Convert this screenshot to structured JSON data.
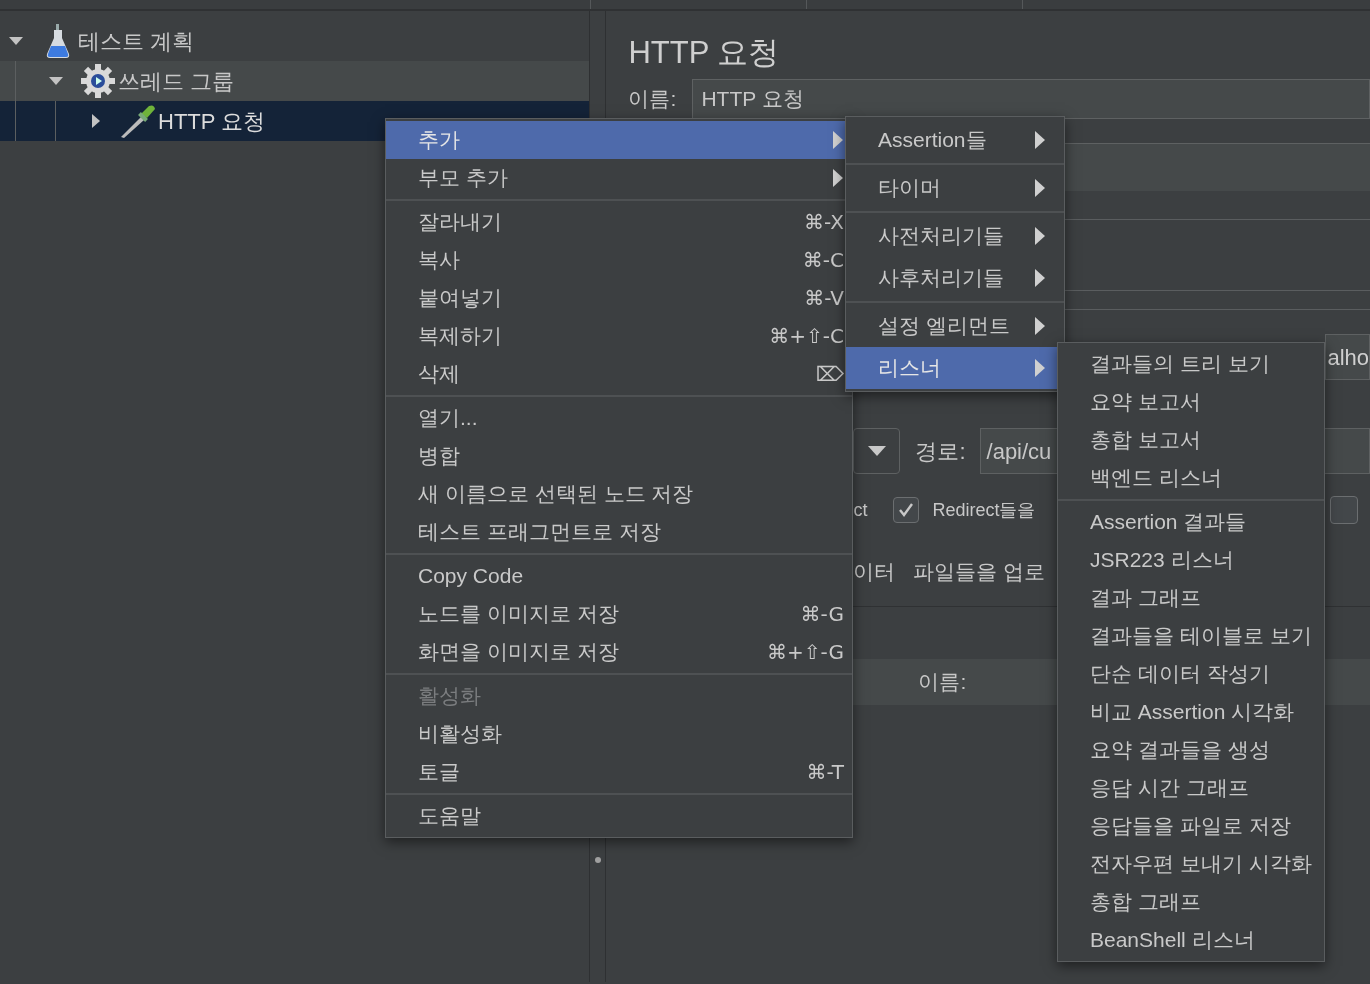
{
  "tree": [
    {
      "label": "테스트 계획",
      "kind": "test-plan",
      "expanded": true,
      "selected": false,
      "children": [
        {
          "label": "쓰레드 그룹",
          "kind": "thread-group",
          "expanded": true,
          "selected": false,
          "children": [
            {
              "label": "HTTP 요청",
              "kind": "sampler",
              "expanded": false,
              "selected": true
            }
          ]
        }
      ]
    }
  ],
  "editor": {
    "title": "HTTP 요청",
    "name_label": "이름:",
    "name_value": "HTTP 요청",
    "server_value": "alho",
    "path_label": "경로:",
    "path_value": "/api/cu",
    "text_1": "ct",
    "redirect": {
      "label": "Redirect들을",
      "checked": true
    },
    "checkbox_2": {
      "checked": false
    },
    "text_2": "이터",
    "text_3": "파일들을 업로",
    "name_label_2": "이름:"
  },
  "context_menu": [
    [
      {
        "label": "추가",
        "submenu": true,
        "selected": true,
        "disabled": false
      },
      {
        "label": "부모 추가",
        "submenu": true,
        "selected": false,
        "disabled": false
      }
    ],
    [
      {
        "label": "잘라내기",
        "shortcut": "⌘-X",
        "selected": false,
        "disabled": false
      },
      {
        "label": "복사",
        "shortcut": "⌘-C",
        "selected": false,
        "disabled": false
      },
      {
        "label": "붙여넣기",
        "shortcut": "⌘-V",
        "selected": false,
        "disabled": false
      },
      {
        "label": "복제하기",
        "shortcut": "⌘+⇧-C",
        "selected": false,
        "disabled": false
      },
      {
        "label": "삭제",
        "shortcut": "⌦",
        "selected": false,
        "disabled": false
      }
    ],
    [
      {
        "label": "열기...",
        "selected": false,
        "disabled": false
      },
      {
        "label": "병합",
        "selected": false,
        "disabled": false
      },
      {
        "label": "새 이름으로 선택된 노드 저장",
        "selected": false,
        "disabled": false
      },
      {
        "label": "테스트 프래그먼트로 저장",
        "selected": false,
        "disabled": false
      }
    ],
    [
      {
        "label": "Copy Code",
        "selected": false,
        "disabled": false
      },
      {
        "label": "노드를 이미지로 저장",
        "shortcut": "⌘-G",
        "selected": false,
        "disabled": false
      },
      {
        "label": "화면을 이미지로 저장",
        "shortcut": "⌘+⇧-G",
        "selected": false,
        "disabled": false
      }
    ],
    [
      {
        "label": "활성화",
        "selected": false,
        "disabled": true
      },
      {
        "label": "비활성화",
        "selected": false,
        "disabled": false
      },
      {
        "label": "토글",
        "shortcut": "⌘-T",
        "selected": false,
        "disabled": false
      }
    ],
    [
      {
        "label": "도움말",
        "selected": false,
        "disabled": false
      }
    ]
  ],
  "add_submenu": [
    [
      {
        "label": "Assertion들",
        "submenu": true,
        "selected": false,
        "disabled": false
      }
    ],
    [
      {
        "label": "타이머",
        "submenu": true,
        "selected": false,
        "disabled": false
      }
    ],
    [
      {
        "label": "사전처리기들",
        "submenu": true,
        "selected": false,
        "disabled": false
      },
      {
        "label": "사후처리기들",
        "submenu": true,
        "selected": false,
        "disabled": false
      }
    ],
    [
      {
        "label": "설정 엘리먼트",
        "submenu": true,
        "selected": false,
        "disabled": false
      },
      {
        "label": "리스너",
        "submenu": true,
        "selected": true,
        "disabled": false
      }
    ]
  ],
  "listener_submenu": [
    [
      {
        "label": "결과들의 트리 보기",
        "selected": false,
        "disabled": false
      },
      {
        "label": "요약 보고서",
        "selected": false,
        "disabled": false
      },
      {
        "label": "총합 보고서",
        "selected": false,
        "disabled": false
      },
      {
        "label": "백엔드 리스너",
        "selected": false,
        "disabled": false
      }
    ],
    [
      {
        "label": "Assertion 결과들",
        "selected": false,
        "disabled": false
      },
      {
        "label": "JSR223 리스너",
        "selected": false,
        "disabled": false
      },
      {
        "label": "결과 그래프",
        "selected": false,
        "disabled": false
      },
      {
        "label": "결과들을 테이블로 보기",
        "selected": false,
        "disabled": false
      },
      {
        "label": "단순 데이터 작성기",
        "selected": false,
        "disabled": false
      },
      {
        "label": "비교 Assertion 시각화",
        "selected": false,
        "disabled": false
      },
      {
        "label": "요약 결과들을 생성",
        "selected": false,
        "disabled": false
      },
      {
        "label": "응답 시간 그래프",
        "selected": false,
        "disabled": false
      },
      {
        "label": "응답들을 파일로 저장",
        "selected": false,
        "disabled": false
      },
      {
        "label": "전자우편 보내기 시각화",
        "selected": false,
        "disabled": false
      },
      {
        "label": "총합 그래프",
        "selected": false,
        "disabled": false
      },
      {
        "label": "BeanShell 리스너",
        "selected": false,
        "disabled": false
      }
    ]
  ]
}
